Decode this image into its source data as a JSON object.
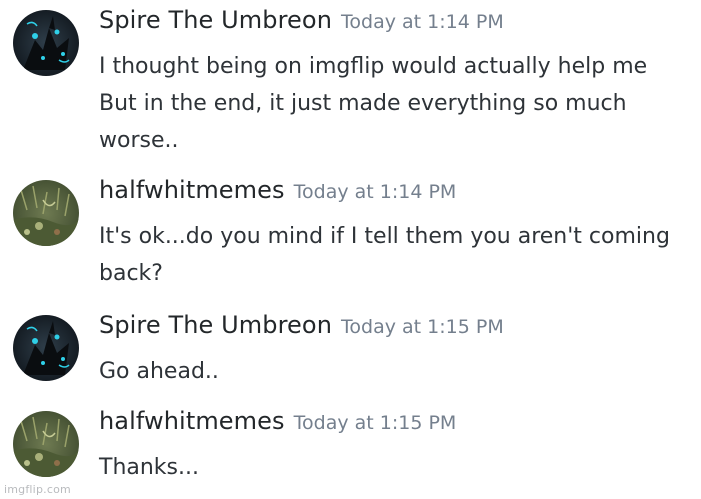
{
  "messages": [
    {
      "author": "Spire The Umbreon",
      "timestamp": "Today at 1:14 PM",
      "avatar_icon": "umbreon-avatar-icon",
      "lines": [
        "I thought being on imgflip would actually help me",
        "But in the end, it just made everything so much",
        "worse.."
      ]
    },
    {
      "author": "halfwhitmemes",
      "timestamp": "Today at 1:14 PM",
      "avatar_icon": "nature-photo-avatar-icon",
      "lines": [
        "It's ok...do you mind if I tell them you aren't coming",
        "back?"
      ]
    },
    {
      "author": "Spire The Umbreon",
      "timestamp": "Today at 1:15 PM",
      "avatar_icon": "umbreon-avatar-icon",
      "lines": [
        "Go ahead.."
      ]
    },
    {
      "author": "halfwhitmemes",
      "timestamp": "Today at 1:15 PM",
      "avatar_icon": "nature-photo-avatar-icon",
      "lines": [
        "Thanks..."
      ]
    }
  ],
  "watermark": "imgflip.com",
  "colors": {
    "username": "#23272a",
    "timestamp": "#747f8d",
    "message_text": "#2e3338"
  }
}
